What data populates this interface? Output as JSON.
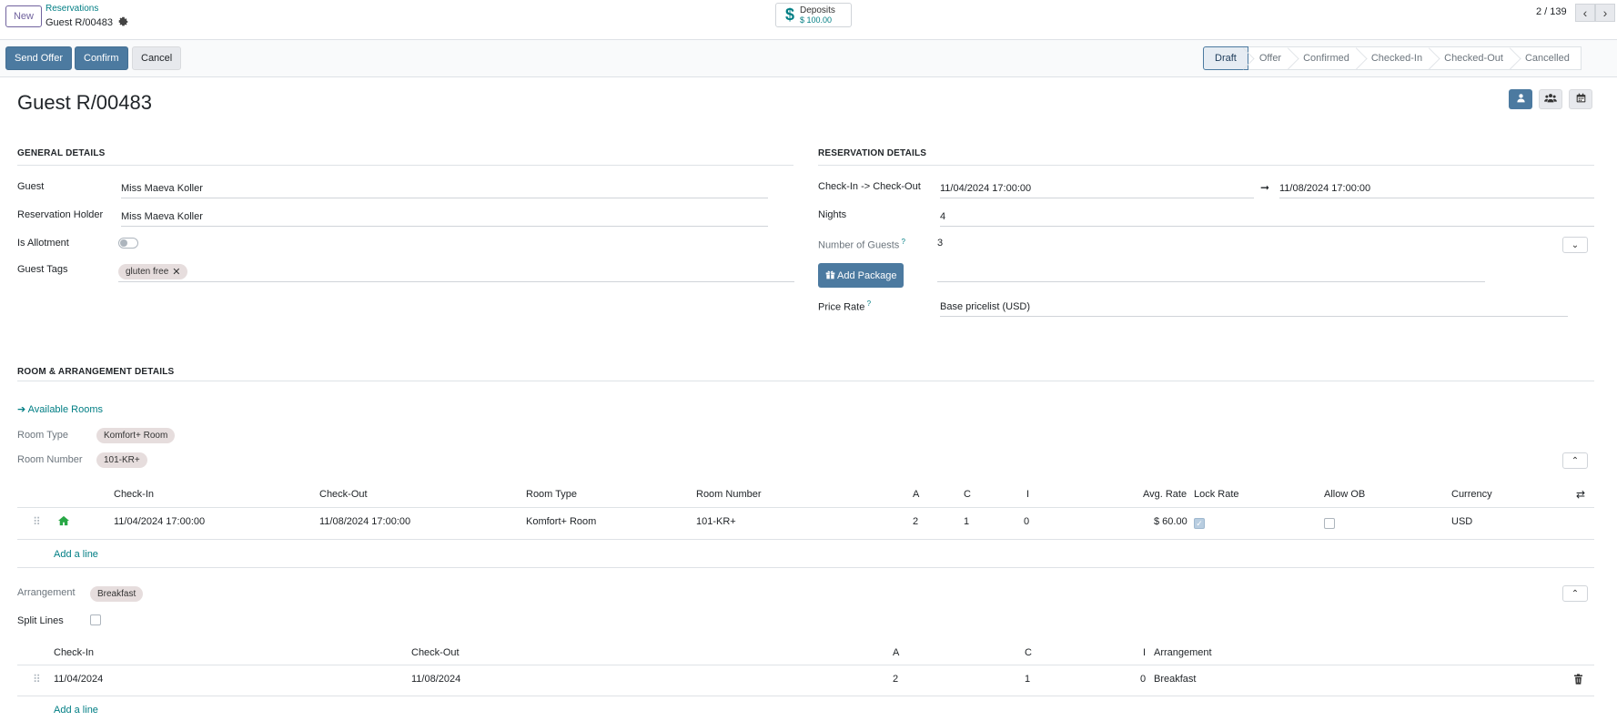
{
  "topbar": {
    "new_label": "New",
    "breadcrumb_parent": "Reservations",
    "breadcrumb_current": "Guest R/00483",
    "deposits_label": "Deposits",
    "deposits_value": "$ 100.00",
    "pager": "2 / 139"
  },
  "actions": {
    "send_offer": "Send Offer",
    "confirm": "Confirm",
    "cancel": "Cancel"
  },
  "statusbar": [
    "Draft",
    "Offer",
    "Confirmed",
    "Checked-In",
    "Checked-Out",
    "Cancelled"
  ],
  "status_active": "Draft",
  "record": {
    "title": "Guest R/00483"
  },
  "general": {
    "section": "GENERAL DETAILS",
    "guest_label": "Guest",
    "guest_value": "Miss Maeva Koller",
    "holder_label": "Reservation Holder",
    "holder_value": "Miss Maeva Koller",
    "allotment_label": "Is Allotment",
    "tags_label": "Guest Tags",
    "tags": [
      "gluten free"
    ]
  },
  "reservation": {
    "section": "RESERVATION DETAILS",
    "checkin_label": "Check-In -> Check-Out",
    "checkin_value": "11/04/2024 17:00:00",
    "checkout_value": "11/08/2024 17:00:00",
    "nights_label": "Nights",
    "nights_value": "4",
    "guests_label": "Number of Guests",
    "guests_value": "3",
    "add_package": "Add Package",
    "price_label": "Price Rate",
    "price_value": "Base pricelist (USD)"
  },
  "room": {
    "section": "ROOM & ARRANGEMENT DETAILS",
    "available_rooms": "Available Rooms",
    "room_type_label": "Room Type",
    "room_type_tag": "Komfort+ Room",
    "room_number_label": "Room Number",
    "room_number_tag": "101-KR+",
    "columns": [
      "Check-In",
      "Check-Out",
      "Room Type",
      "Room Number",
      "A",
      "C",
      "I",
      "Avg. Rate",
      "Lock Rate",
      "Allow OB",
      "Currency"
    ],
    "row": {
      "checkin": "11/04/2024 17:00:00",
      "checkout": "11/08/2024 17:00:00",
      "room_type": "Komfort+ Room",
      "room_number": "101-KR+",
      "a": "2",
      "c": "1",
      "i": "0",
      "avg_rate": "$ 60.00",
      "currency": "USD"
    },
    "add_line": "Add a line"
  },
  "arrangement": {
    "label": "Arrangement",
    "tag": "Breakfast",
    "split_label": "Split Lines",
    "columns": [
      "Check-In",
      "Check-Out",
      "A",
      "C",
      "I",
      "Arrangement"
    ],
    "row": {
      "checkin": "11/04/2024",
      "checkout": "11/08/2024",
      "a": "2",
      "c": "1",
      "i": "0",
      "arrangement": "Breakfast"
    },
    "add_line": "Add a line"
  },
  "colors": {
    "primary": "#4c7aa0",
    "link": "#017e84",
    "tag_bg": "#e6dddd"
  }
}
